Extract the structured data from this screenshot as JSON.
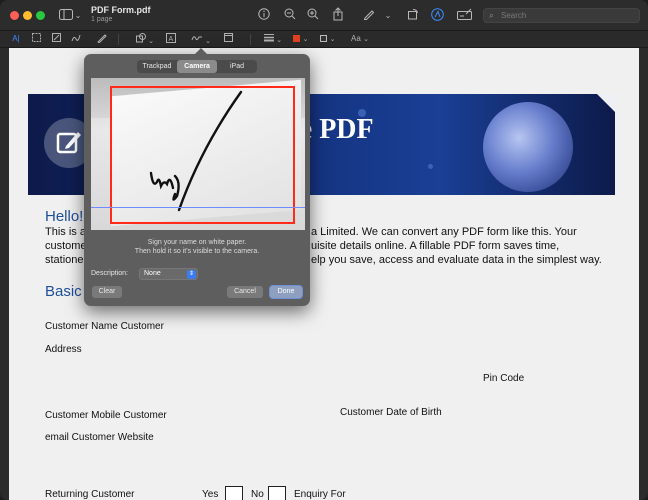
{
  "titlebar": {
    "doc_title": "PDF Form.pdf",
    "doc_subtitle": "1 page",
    "search_placeholder": "Search"
  },
  "markup_toolbar": {
    "text_tool": "A|",
    "font_label": "Aa",
    "shape_color": "#e0401f",
    "fill_color": "#333333"
  },
  "document": {
    "banner_title": "le PDF",
    "hello_heading": "Hello!",
    "body_lines": [
      "This is a",
      "a Limited. We can convert any PDF form like this. Your",
      "custome",
      "uisite details online. A fillable PDF form saves time,",
      "statione",
      "elp you save, access and evaluate data in the simplest way."
    ],
    "basic_heading": "Basic",
    "fields": {
      "customer_name": "Customer Name Customer",
      "address": "Address",
      "pin_code": "Pin Code",
      "customer_mobile": "Customer Mobile  Customer",
      "customer_dob": "Customer Date of Birth",
      "email_website": "email Customer Website",
      "returning_customer": "Returning Customer",
      "yes": "Yes",
      "no": "No",
      "enquiry_for": "Enquiry For"
    }
  },
  "signature_popover": {
    "tabs": [
      {
        "label": "Trackpad",
        "active": false
      },
      {
        "label": "Camera",
        "active": true
      },
      {
        "label": "iPad",
        "active": false
      }
    ],
    "instruction_line1": "Sign your name on white paper.",
    "instruction_line2": "Then hold it so it’s visible to the camera.",
    "description_label": "Description:",
    "description_value": "None",
    "clear_label": "Clear",
    "cancel_label": "Cancel",
    "done_label": "Done",
    "frame_color": "#ff2a1a"
  }
}
